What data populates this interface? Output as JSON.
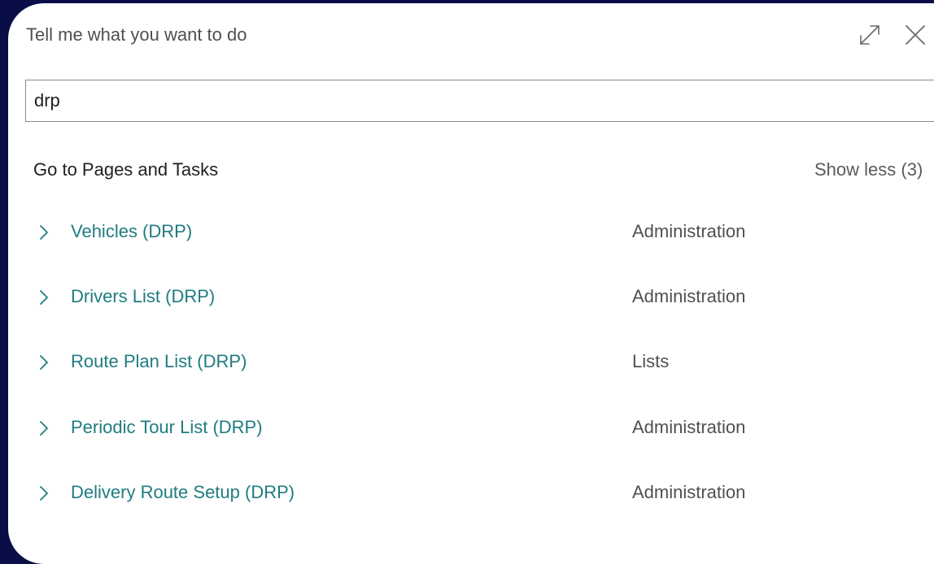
{
  "dialog": {
    "title": "Tell me what you want to do",
    "expand_icon": "expand-icon",
    "close_icon": "close-icon"
  },
  "search": {
    "value": "drp",
    "placeholder": ""
  },
  "section": {
    "title": "Go to Pages and Tasks",
    "toggle_label": "Show less (3)"
  },
  "results": [
    {
      "name": "Vehicles (DRP)",
      "category": "Administration",
      "icon": "chevron-right-icon"
    },
    {
      "name": "Drivers List (DRP)",
      "category": "Administration",
      "icon": "chevron-right-icon"
    },
    {
      "name": "Route Plan List (DRP)",
      "category": "Lists",
      "icon": "chevron-right-icon"
    },
    {
      "name": "Periodic Tour List (DRP)",
      "category": "Administration",
      "icon": "chevron-right-icon"
    },
    {
      "name": "Delivery Route Setup (DRP)",
      "category": "Administration",
      "icon": "chevron-right-icon"
    }
  ],
  "colors": {
    "background": "#0a0e47",
    "link": "#1f7c80",
    "text": "#212121",
    "muted": "#505050"
  }
}
